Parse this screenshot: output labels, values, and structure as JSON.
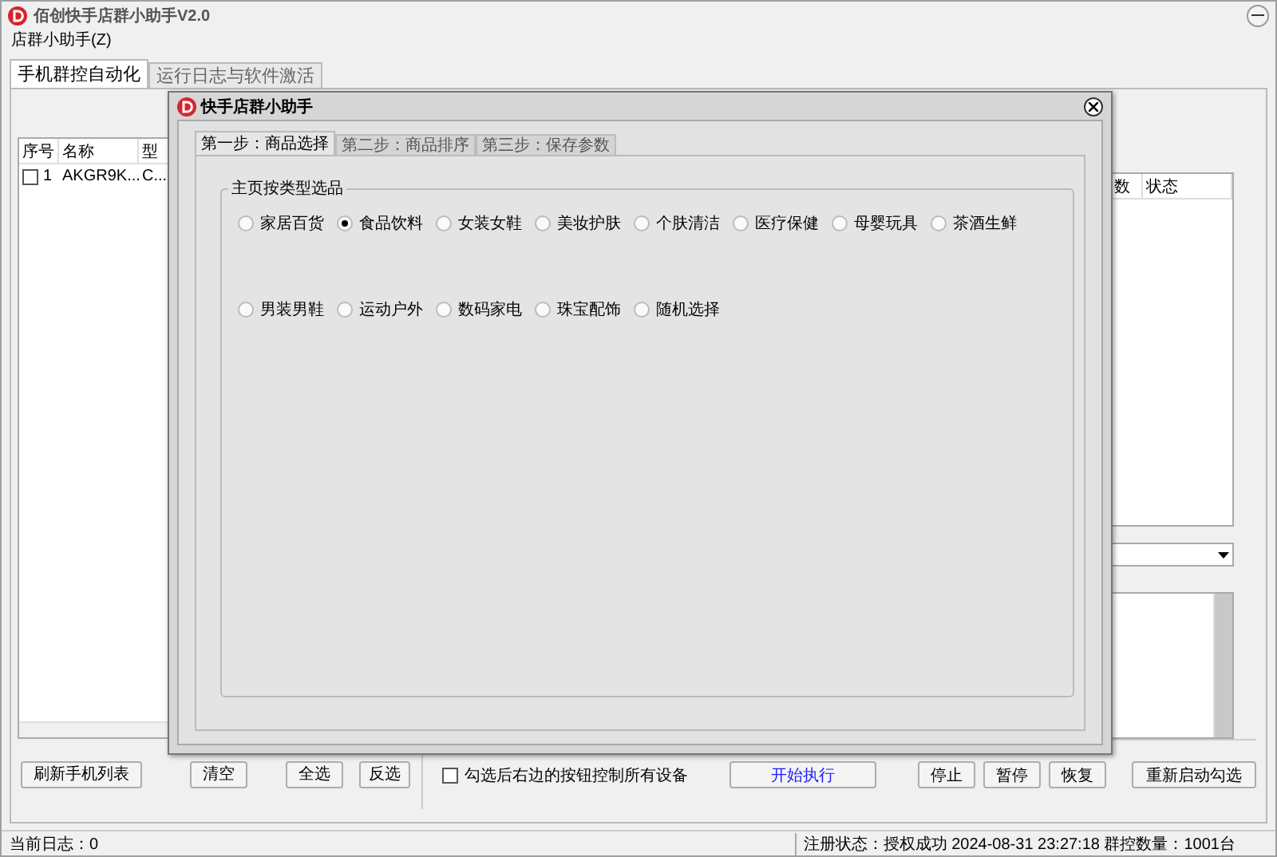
{
  "window": {
    "title": "佰创快手店群小助手V2.0"
  },
  "menu": [
    "店群小助手(Z)"
  ],
  "tabs": [
    {
      "label": "手机群控自动化",
      "selected": true
    },
    {
      "label": "运行日志与软件激活",
      "selected": false
    }
  ],
  "device_list": {
    "columns": [
      "序号",
      "名称",
      "型"
    ],
    "rows": [
      {
        "checked": false,
        "index": "1",
        "name": "AKGR9K...",
        "column_3": "C..."
      }
    ]
  },
  "task_list": {
    "columns": [
      "数",
      "状态"
    ]
  },
  "left_buttons": [
    "刷新手机列表",
    "清空",
    "全选",
    "反选"
  ],
  "control_all": {
    "label": "勾选后右边的按钮控制所有设备",
    "checked": false
  },
  "start_button": "开始执行",
  "right_buttons": [
    "停止",
    "暂停",
    "恢复"
  ],
  "restart_button": "重新启动勾选",
  "status_bar": {
    "log": "当前日志：0",
    "registration": "注册状态：授权成功 2024-08-31 23:27:18 群控数量：1001台"
  },
  "dialog": {
    "title": "快手店群小助手",
    "tabs": [
      {
        "label": "第一步：商品选择",
        "selected": true
      },
      {
        "label": "第二步：商品排序",
        "selected": false
      },
      {
        "label": "第三步：保存参数",
        "selected": false
      }
    ],
    "group_title": "主页按类型选品",
    "option_rows": [
      [
        {
          "label": "家居百货",
          "selected": false
        },
        {
          "label": "食品饮料",
          "selected": true
        },
        {
          "label": "女装女鞋",
          "selected": false
        },
        {
          "label": "美妆护肤",
          "selected": false
        },
        {
          "label": "个肤清洁",
          "selected": false
        },
        {
          "label": "医疗保健",
          "selected": false
        },
        {
          "label": "母婴玩具",
          "selected": false
        },
        {
          "label": "茶酒生鲜",
          "selected": false
        }
      ],
      [
        {
          "label": "男装男鞋",
          "selected": false
        },
        {
          "label": "运动户外",
          "selected": false
        },
        {
          "label": "数码家电",
          "selected": false
        },
        {
          "label": "珠宝配饰",
          "selected": false
        },
        {
          "label": "随机选择",
          "selected": false
        }
      ]
    ]
  }
}
